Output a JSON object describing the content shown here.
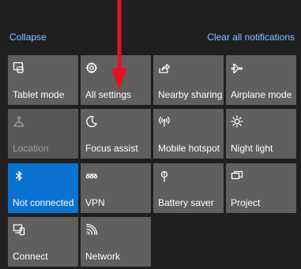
{
  "header": {
    "collapse_label": "Collapse",
    "clear_label": "Clear all notifications",
    "link_color": "#8fc3ff"
  },
  "tiles": [
    {
      "label": "Tablet mode",
      "icon": "tablet-mode-icon",
      "state": "off"
    },
    {
      "label": "All settings",
      "icon": "gear-icon",
      "state": "off"
    },
    {
      "label": "Nearby sharing",
      "icon": "nearby-sharing-icon",
      "state": "off"
    },
    {
      "label": "Airplane mode",
      "icon": "airplane-icon",
      "state": "off"
    },
    {
      "label": "Location",
      "icon": "location-icon",
      "state": "disabled"
    },
    {
      "label": "Focus assist",
      "icon": "moon-icon",
      "state": "off"
    },
    {
      "label": "Mobile hotspot",
      "icon": "hotspot-icon",
      "state": "off"
    },
    {
      "label": "Night light",
      "icon": "brightness-icon",
      "state": "off"
    },
    {
      "label": "Not connected",
      "icon": "bluetooth-icon",
      "state": "on"
    },
    {
      "label": "VPN",
      "icon": "vpn-icon",
      "state": "off"
    },
    {
      "label": "Battery saver",
      "icon": "battery-saver-icon",
      "state": "off"
    },
    {
      "label": "Project",
      "icon": "project-icon",
      "state": "off"
    },
    {
      "label": "Connect",
      "icon": "connect-icon",
      "state": "off"
    },
    {
      "label": "Network",
      "icon": "network-icon",
      "state": "off"
    }
  ],
  "colors": {
    "background": "#1f1f1f",
    "tile": "#5f5f5f",
    "tile_on": "#0a73d2",
    "arrow": "#e81123"
  }
}
